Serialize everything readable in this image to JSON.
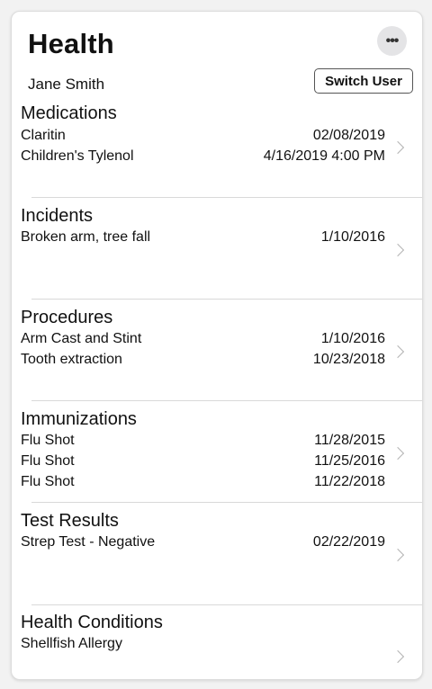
{
  "header": {
    "title": "Health",
    "more_label": "•••",
    "user_name": "Jane Smith",
    "switch_user_label": "Switch User"
  },
  "sections": [
    {
      "title": "Medications",
      "rows": [
        {
          "label": "Claritin",
          "value": "02/08/2019"
        },
        {
          "label": "Children's Tylenol",
          "value": "4/16/2019 4:00 PM"
        }
      ]
    },
    {
      "title": "Incidents",
      "rows": [
        {
          "label": "Broken arm, tree fall",
          "value": "1/10/2016"
        }
      ]
    },
    {
      "title": "Procedures",
      "rows": [
        {
          "label": "Arm Cast and Stint",
          "value": "1/10/2016"
        },
        {
          "label": "Tooth extraction",
          "value": "10/23/2018"
        }
      ]
    },
    {
      "title": "Immunizations",
      "rows": [
        {
          "label": "Flu Shot",
          "value": "11/28/2015"
        },
        {
          "label": "Flu Shot",
          "value": "11/25/2016"
        },
        {
          "label": "Flu Shot",
          "value": "11/22/2018"
        }
      ]
    },
    {
      "title": "Test Results",
      "rows": [
        {
          "label": "Strep Test - Negative",
          "value": "02/22/2019"
        }
      ]
    },
    {
      "title": "Health Conditions",
      "rows": [
        {
          "label": "Shellfish Allergy",
          "value": ""
        }
      ]
    }
  ]
}
